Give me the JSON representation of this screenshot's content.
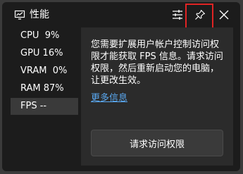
{
  "window": {
    "title": "性能",
    "title_icon": "performance-icon",
    "buttons": {
      "settings_icon": "settings-sliders-icon",
      "pin_icon": "pin-icon",
      "close_icon": "close-icon"
    },
    "highlight_color": "#e02424"
  },
  "sidebar": {
    "items": [
      {
        "label": "CPU  9%"
      },
      {
        "label": "GPU 16%"
      },
      {
        "label": "VRAM  0%"
      },
      {
        "label": "RAM 87%"
      },
      {
        "label": "FPS --",
        "active": true
      }
    ]
  },
  "content": {
    "message": "您需要扩展用户帐户控制访问权限才能获取 FPS 信息。请求访问权限，然后重新启动您的电脑，让更改生效。",
    "link_text": "更多信息",
    "button_label": "请求访问权限",
    "link_color": "#5aa8f0"
  }
}
